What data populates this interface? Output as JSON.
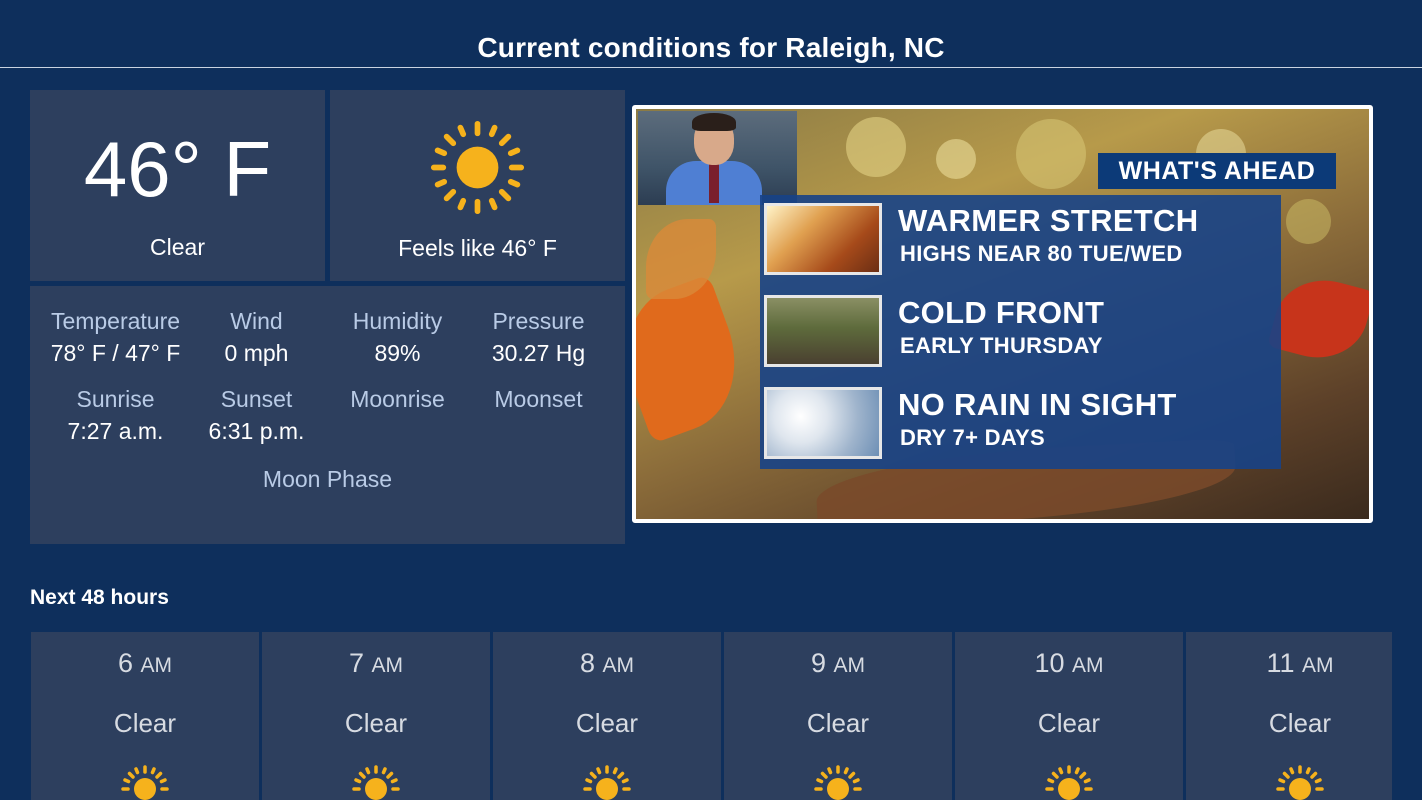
{
  "header": {
    "title": "Current conditions for Raleigh, NC"
  },
  "current": {
    "temperature": "46° F",
    "condition": "Clear",
    "feels_like": "Feels like 46° F",
    "icon": "sun-icon"
  },
  "details": {
    "temperature": {
      "label": "Temperature",
      "value": "78° F  / 47° F"
    },
    "wind": {
      "label": "Wind",
      "value": "0 mph"
    },
    "humidity": {
      "label": "Humidity",
      "value": "89%"
    },
    "pressure": {
      "label": "Pressure",
      "value": "30.27 Hg"
    },
    "sunrise": {
      "label": "Sunrise",
      "value": "7:27 a.m."
    },
    "sunset": {
      "label": "Sunset",
      "value": "6:31 p.m."
    },
    "moonrise": {
      "label": "Moonrise",
      "value": ""
    },
    "moonset": {
      "label": "Moonset",
      "value": ""
    },
    "moon_phase": {
      "label": "Moon Phase"
    }
  },
  "promo": {
    "badge": "WHAT'S AHEAD",
    "items": [
      {
        "headline": "WARMER STRETCH",
        "subline": "HIGHS NEAR 80 TUE/WED"
      },
      {
        "headline": "COLD FRONT",
        "subline": "EARLY THURSDAY"
      },
      {
        "headline": "NO RAIN IN SIGHT",
        "subline": "DRY 7+ DAYS"
      }
    ]
  },
  "forecast": {
    "title": "Next 48 hours",
    "hours": [
      {
        "hour": "6",
        "ampm": "AM",
        "condition": "Clear",
        "icon": "sun-icon"
      },
      {
        "hour": "7",
        "ampm": "AM",
        "condition": "Clear",
        "icon": "sun-icon"
      },
      {
        "hour": "8",
        "ampm": "AM",
        "condition": "Clear",
        "icon": "sun-icon"
      },
      {
        "hour": "9",
        "ampm": "AM",
        "condition": "Clear",
        "icon": "sun-icon"
      },
      {
        "hour": "10",
        "ampm": "AM",
        "condition": "Clear",
        "icon": "sun-icon"
      },
      {
        "hour": "11",
        "ampm": "AM",
        "condition": "Clear",
        "icon": "sun-icon"
      }
    ]
  },
  "colors": {
    "background": "#0e2f5c",
    "panel": "#2d3f5e",
    "label": "#b9cbe6",
    "sun": "#f6b21c"
  }
}
